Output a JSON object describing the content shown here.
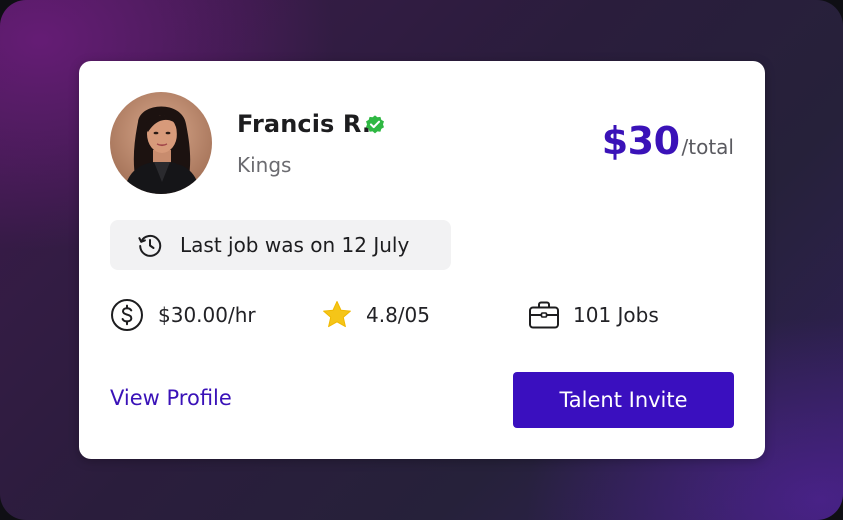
{
  "talent": {
    "name": "Francis R.",
    "location": "Kings",
    "verified": true
  },
  "price": {
    "amount": "$30",
    "unit": "/total"
  },
  "last_job": {
    "text": "Last job was on 12 July"
  },
  "stats": {
    "rate": "$30.00/hr",
    "rating": "4.8/05",
    "jobs": "101 Jobs"
  },
  "actions": {
    "view_profile": "View Profile",
    "talent_invite": "Talent Invite"
  },
  "icons": {
    "verified": "verified-badge-icon",
    "history": "history-icon",
    "rate": "dollar-circle-icon",
    "rating": "star-icon",
    "jobs": "briefcase-icon"
  },
  "colors": {
    "accent": "#3a12b8",
    "button": "#3a0fbf",
    "verified": "#2fb843",
    "star": "#f5c518"
  }
}
